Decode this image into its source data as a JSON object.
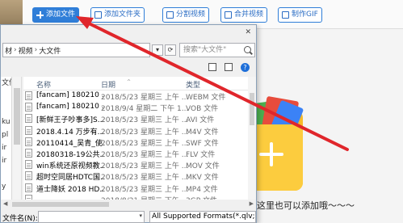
{
  "toolbar": {
    "add_file": "添加文件",
    "add_folder": "添加文件夹",
    "split_video": "分割视频",
    "merge_video": "合并视频",
    "make_gif": "制作GIF"
  },
  "drop_hint": "这里也可以添加哦～～～",
  "dialog": {
    "breadcrumb": [
      "材",
      "视频",
      "大文件"
    ],
    "search_placeholder": "搜索\"大文件\"",
    "left_nav": [
      "文件夹",
      "",
      "",
      "ku",
      "pl",
      "ir",
      "ir",
      "",
      "y",
      "ma",
      "",
      "lo"
    ],
    "columns": {
      "name": "名称",
      "date": "日期",
      "type": "类型"
    },
    "files": [
      {
        "name": "[fancam] 180210 ...",
        "date": "2018/5/23 星期三 上午 ...",
        "type": "WEBM 文件"
      },
      {
        "name": "[fancam] 180210 ...",
        "date": "2018/9/4 星期二 下午 1...",
        "type": "VOB 文件"
      },
      {
        "name": "[新鲜王子吵事多]S...",
        "date": "2018/5/23 星期三 上午 ...",
        "type": "AVI 文件"
      },
      {
        "name": "2018.4.14 万步有...",
        "date": "2018/5/23 星期三 上午 ...",
        "type": "M4V 文件"
      },
      {
        "name": "20110414_吴青_使...",
        "date": "2018/5/23 星期三 上午 ...",
        "type": "SWF 文件"
      },
      {
        "name": "20180318-19公共...",
        "date": "2018/5/23 星期三 上午 ...",
        "type": "FLV 文件"
      },
      {
        "name": "win系统还原视频教...",
        "date": "2018/5/23 星期三 上午 ...",
        "type": "MOV 文件"
      },
      {
        "name": "超时空同居HDTC国...",
        "date": "2018/5/23 星期三 上午 ...",
        "type": "MKV 文件"
      },
      {
        "name": "道士降妖 2018 HD...",
        "date": "2018/5/23 星期三 上午 ...",
        "type": "MP4 文件"
      },
      {
        "name": "",
        "date": "2018/8/21 星期二 下午 ...",
        "type": "3GP 文件"
      }
    ],
    "filename_label": "文件名(N):",
    "filename_value": "",
    "filter": "All Supported Formats(*.qlv;"
  },
  "colors": {
    "accent": "#2f7ed8",
    "arrow": "#e0262b",
    "folder": "#fccc3e"
  }
}
